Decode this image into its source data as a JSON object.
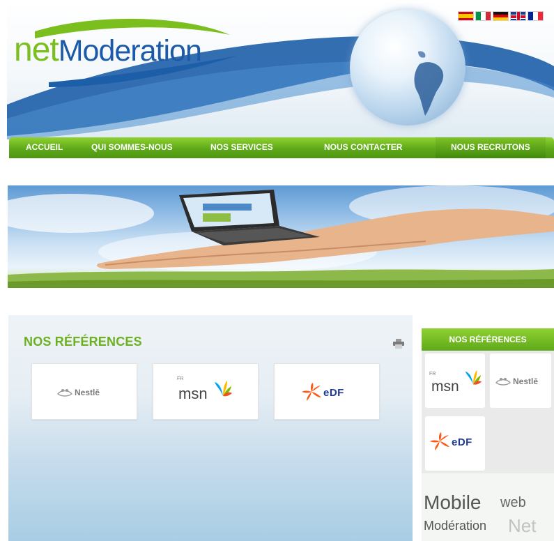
{
  "header": {
    "logo_part1": "net",
    "logo_part2": "Moderation",
    "flags": [
      {
        "name": "Español",
        "icon": "flag-es"
      },
      {
        "name": "Italiano",
        "icon": "flag-it"
      },
      {
        "name": "Deutsch",
        "icon": "flag-de"
      },
      {
        "name": "English",
        "icon": "flag-uk"
      },
      {
        "name": "Français",
        "icon": "flag-fr"
      }
    ]
  },
  "nav": {
    "items": [
      {
        "label": "ACCUEIL"
      },
      {
        "label": "QUI SOMMES-NOUS"
      },
      {
        "label": "NOS SERVICES"
      },
      {
        "label": "NOUS CONTACTER"
      },
      {
        "label": "NOUS RECRUTONS"
      }
    ],
    "active_index": 4
  },
  "references": {
    "title": "NOS RÉFÉRENCES",
    "print_icon": "print-icon",
    "cards": [
      {
        "brand": "Nestlé",
        "text": "Nestlē"
      },
      {
        "brand": "MSN",
        "text": "msn",
        "region": "FR"
      },
      {
        "brand": "EDF",
        "text": "eDF"
      }
    ]
  },
  "sidebar": {
    "title": "NOS RÉFÉRENCES",
    "cards": [
      {
        "brand": "MSN",
        "text": "msn",
        "region": "FR"
      },
      {
        "brand": "Nestlé",
        "text": "Nestlē"
      },
      {
        "brand": "EDF",
        "text": "eDF"
      }
    ],
    "tags": [
      {
        "label": "Mobile"
      },
      {
        "label": "web"
      },
      {
        "label": "Modération"
      },
      {
        "label": "Net"
      }
    ]
  },
  "colors": {
    "brand_green": "#6db021",
    "brand_blue": "#1b5aa8",
    "nav_green": "#5ea91a"
  }
}
